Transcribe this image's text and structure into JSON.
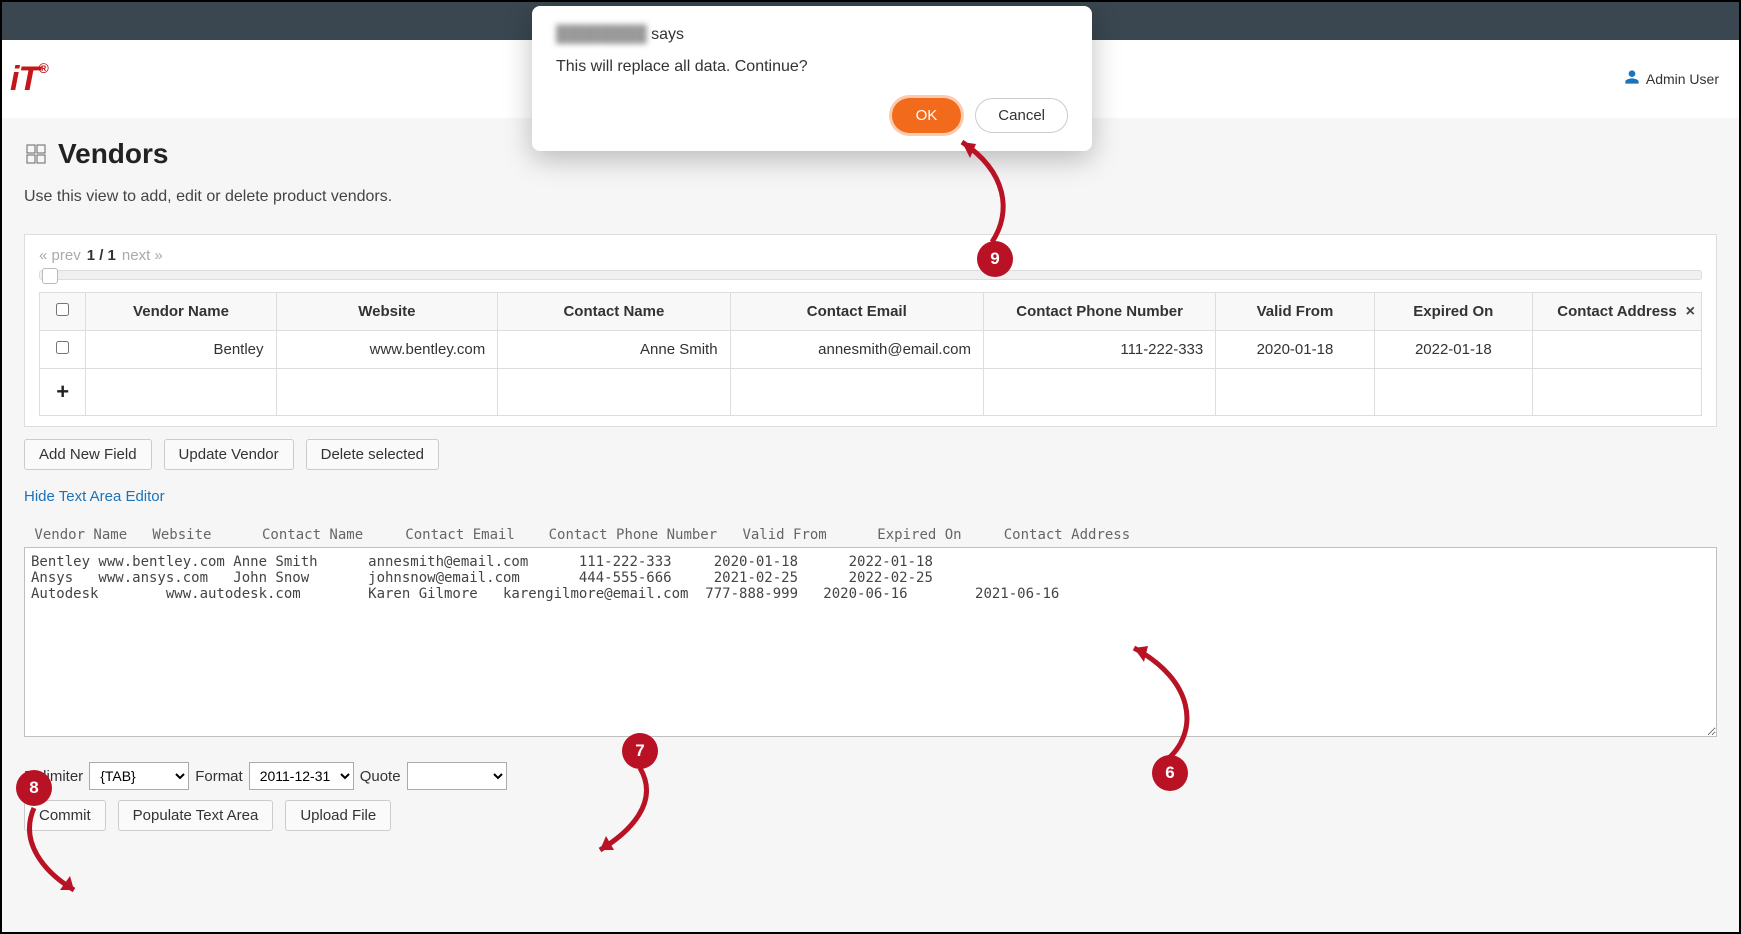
{
  "header": {
    "logo": "iT",
    "user_label": "Admin User"
  },
  "page": {
    "title": "Vendors",
    "subtitle": "Use this view to add, edit or delete product vendors."
  },
  "pager": {
    "prev": "« prev",
    "pos": "1 / 1",
    "next": "next »"
  },
  "table": {
    "headers": {
      "vendor_name": "Vendor Name",
      "website": "Website",
      "contact_name": "Contact Name",
      "contact_email": "Contact Email",
      "contact_phone": "Contact Phone Number",
      "valid_from": "Valid From",
      "expired_on": "Expired On",
      "contact_address": "Contact Address"
    },
    "rows": [
      {
        "vendor_name": "Bentley",
        "website": "www.bentley.com",
        "contact_name": "Anne Smith",
        "contact_email": "annesmith@email.com",
        "contact_phone": "111-222-333",
        "valid_from": "2020-01-18",
        "expired_on": "2022-01-18",
        "contact_address": ""
      }
    ]
  },
  "buttons": {
    "add_field": "Add New Field",
    "update_vendor": "Update Vendor",
    "delete_selected": "Delete selected",
    "hide_editor": "Hide Text Area Editor",
    "commit": "Commit",
    "populate": "Populate Text Area",
    "upload": "Upload File"
  },
  "editor": {
    "headers_line": " Vendor Name   Website      Contact Name     Contact Email    Contact Phone Number   Valid From      Expired On     Contact Address",
    "text": "Bentley www.bentley.com Anne Smith      annesmith@email.com      111-222-333     2020-01-18      2022-01-18\nAnsys   www.ansys.com   John Snow       johnsnow@email.com       444-555-666     2021-02-25      2022-02-25\nAutodesk        www.autodesk.com        Karen Gilmore   karengilmore@email.com  777-888-999   2020-06-16        2021-06-16"
  },
  "options": {
    "delimiter_label": "Delimiter",
    "delimiter_value": "{TAB}",
    "format_label": "Format",
    "format_value": "2011-12-31",
    "quote_label": "Quote",
    "quote_value": ""
  },
  "dialog": {
    "source_hidden": "████████",
    "says": " says",
    "message": "This will replace all data. Continue?",
    "ok": "OK",
    "cancel": "Cancel"
  },
  "annotations": {
    "b6": "6",
    "b7": "7",
    "b8": "8",
    "b9": "9"
  }
}
